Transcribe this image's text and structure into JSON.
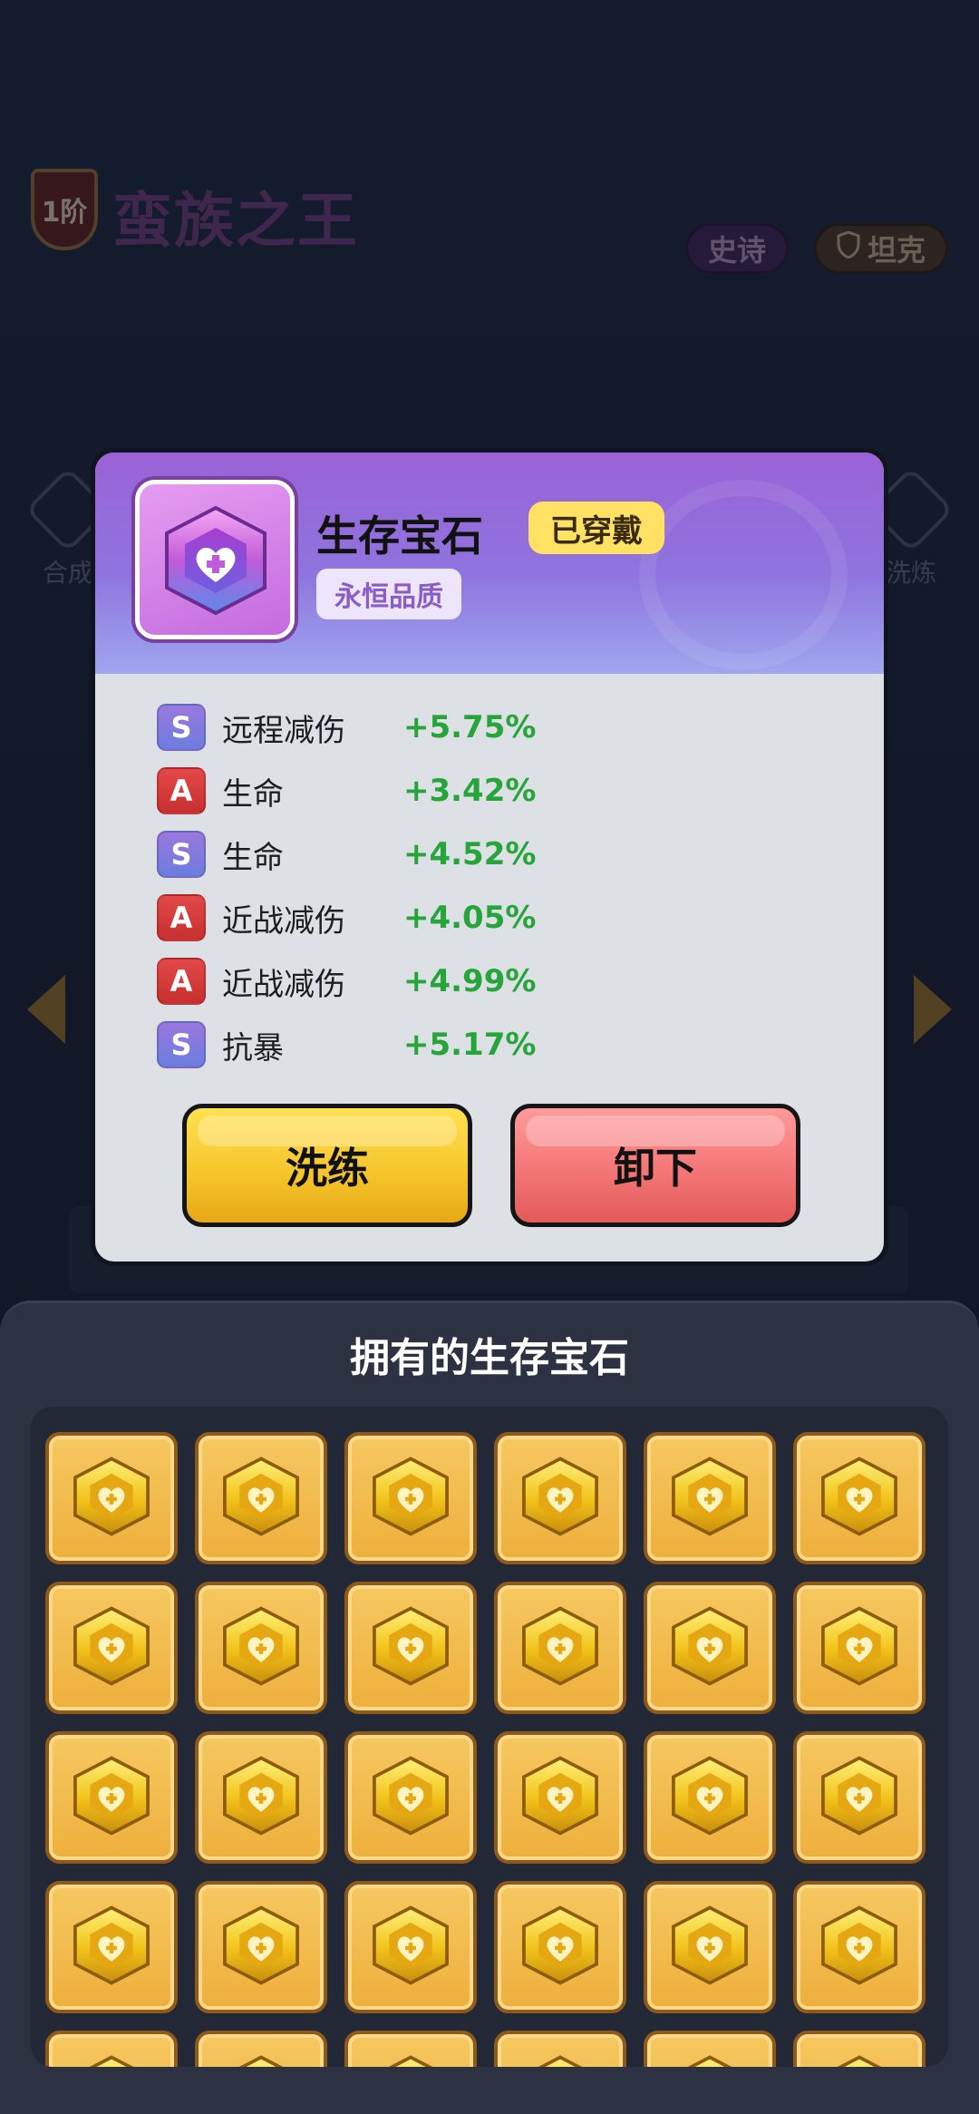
{
  "background": {
    "rank_badge": "1阶",
    "hero_name": "蛮族之王",
    "tags": [
      {
        "label": "史诗",
        "icon": "none"
      },
      {
        "label": "坦克",
        "icon": "shield-icon"
      }
    ],
    "side_buttons": {
      "left": "合成",
      "right": "洗炼"
    }
  },
  "popup": {
    "gem_name": "生存宝石",
    "equipped_label": "已穿戴",
    "quality_label": "永恒品质",
    "stats": [
      {
        "grade": "S",
        "name": "远程减伤",
        "value": "+5.75%"
      },
      {
        "grade": "A",
        "name": "生命",
        "value": "+3.42%"
      },
      {
        "grade": "S",
        "name": "生命",
        "value": "+4.52%"
      },
      {
        "grade": "A",
        "name": "近战减伤",
        "value": "+4.05%"
      },
      {
        "grade": "A",
        "name": "近战减伤",
        "value": "+4.99%"
      },
      {
        "grade": "S",
        "name": "抗暴",
        "value": "+5.17%"
      }
    ],
    "refine_button": "洗练",
    "unequip_button": "卸下"
  },
  "inventory": {
    "title": "拥有的生存宝石",
    "slot_count": 30
  },
  "colors": {
    "stat_value": "#26a53a",
    "grade_S": "#8a7ae0",
    "grade_A": "#d83c3c",
    "refine_button": "#f5c42a",
    "unequip_button": "#f27373",
    "slot_gold": "#f0b542"
  }
}
